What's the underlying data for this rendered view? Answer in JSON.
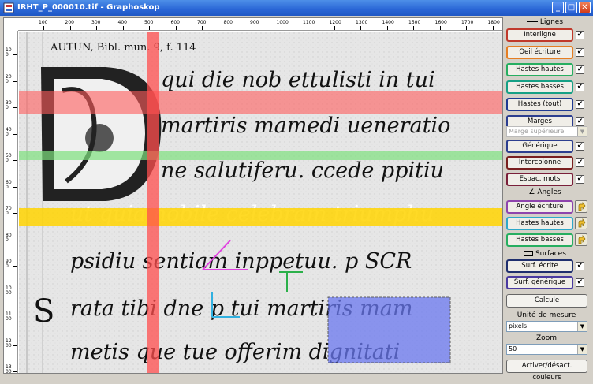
{
  "window": {
    "title": "IRHT_P_000010.tif - Graphoskop",
    "minimize": "_",
    "maximize": "□",
    "close": "✕"
  },
  "ruler": {
    "h_ticks": [
      "100",
      "200",
      "300",
      "400",
      "500",
      "600",
      "700",
      "800",
      "900",
      "1000",
      "1100",
      "1200",
      "1300",
      "1400",
      "1500",
      "1600",
      "1700",
      "1800"
    ],
    "v_ticks": [
      "100",
      "200",
      "300",
      "400",
      "500",
      "600",
      "700",
      "800",
      "900",
      "1000",
      "1100",
      "1200",
      "1300"
    ]
  },
  "image": {
    "caption": "AUTUN, Bibl. mun. 9, f. 114",
    "lines": [
      "qui die nob ettulisti in tui",
      "martiris mamedi ueneratio",
      "ne salutiferu. ccede ppitiu",
      "ut quia nobile celebram triumphu",
      "psidiu sentiam inppetuu. p SCR",
      "rata tibi dne p tui martiris mam",
      "metis que tue offerim dignitati"
    ],
    "initials": [
      "D",
      "S"
    ]
  },
  "panel": {
    "lignes_header": "Lignes",
    "buttons_lignes": [
      {
        "label": "Interligne",
        "color": "#c0392b",
        "checked": "✔"
      },
      {
        "label": "Oeil écriture",
        "color": "#e67e22",
        "checked": "✔"
      },
      {
        "label": "Hastes hautes",
        "color": "#27ae60",
        "checked": "✔"
      },
      {
        "label": "Hastes basses",
        "color": "#16a085",
        "checked": "✔"
      },
      {
        "label": "Hastes (tout)",
        "color": "#1f3a93",
        "checked": "✔"
      },
      {
        "label": "Marges",
        "color": "#2c3e8f",
        "checked": "✔"
      }
    ],
    "marge_select": "Marge supérieure",
    "buttons_other": [
      {
        "label": "Générique",
        "color": "#2c3e8f",
        "checked": "✔"
      },
      {
        "label": "Intercolonne",
        "color": "#7a1f1f",
        "checked": "✔"
      },
      {
        "label": "Espac. mots",
        "color": "#7a1f3a",
        "checked": "✔"
      }
    ],
    "angles_header": "Angles",
    "buttons_angles": [
      {
        "label": "Angle écriture",
        "color": "#8e44ad"
      },
      {
        "label": "Hastes hautes",
        "color": "#2ea8c9"
      },
      {
        "label": "Hastes basses",
        "color": "#27ae60"
      }
    ],
    "surfaces_header": "Surfaces",
    "buttons_surfaces": [
      {
        "label": "Surf. écrite",
        "color": "#1f2f6e",
        "checked": "✔"
      },
      {
        "label": "Surf. générique",
        "color": "#4a3aa0",
        "checked": "✔"
      }
    ],
    "calcule": "Calcule",
    "unit_label": "Unité de mesure",
    "unit_value": "pixels",
    "zoom_label": "Zoom",
    "zoom_value": "50",
    "toggle_colors": "Activer/désact. couleurs"
  }
}
